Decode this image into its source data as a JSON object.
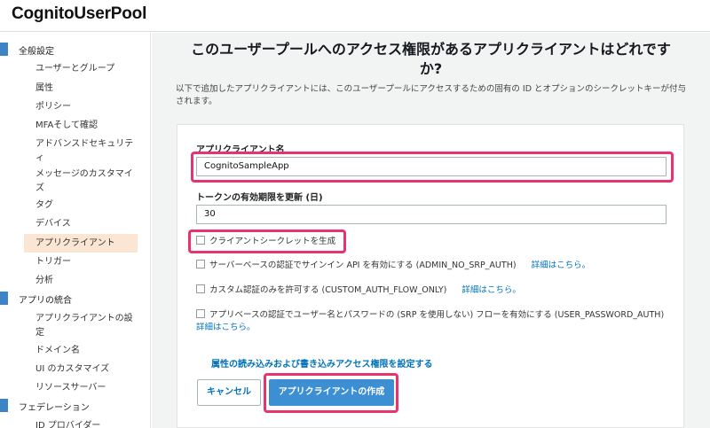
{
  "app": {
    "title": "CognitoUserPool"
  },
  "sidebar": {
    "sections": [
      {
        "label": "全般設定"
      },
      {
        "label": "アプリの統合"
      },
      {
        "label": "フェデレーション"
      }
    ],
    "general_items": [
      "ユーザーとグループ",
      "属性",
      "ポリシー",
      "MFAそして確認",
      "アドバンスドセキュリティ",
      "メッセージのカスタマイズ",
      "タグ",
      "デバイス",
      "アプリクライアント",
      "トリガー",
      "分析"
    ],
    "advanced_security_line1": "アドバンスドセキュリテ",
    "advanced_security_line2": "ィ",
    "message_custom_line1": "メッセージのカスタマイ",
    "message_custom_line2": "ズ",
    "integration_items": [
      "アプリクライアントの設定",
      "ドメイン名",
      "UI のカスタマイズ",
      "リソースサーバー"
    ],
    "app_client_settings_line1": "アプリクライアントの設",
    "app_client_settings_line2": "定",
    "federation_items": [
      "ID プロバイダー"
    ]
  },
  "main": {
    "heading_line1": "このユーザープールへのアクセス権限があるアプリクライアントはどれです",
    "heading_line2": "か?",
    "desc_line1": "以下で追加したアプリクライアントには、このユーザープールにアクセスするための固有の ID とオプションのシークレットキーが付与",
    "desc_line2": "されます。"
  },
  "form": {
    "client_name_label": "アプリクライアント名",
    "client_name_value": "CognitoSampleApp",
    "token_label": "トークンの有効期限を更新 (日)",
    "token_value": "30",
    "generate_secret": "クライアントシークレットを生成",
    "srp_auth": "サーバーベースの認証でサインイン API を有効にする (ADMIN_NO_SRP_AUTH)",
    "custom_auth": "カスタム認証のみを許可する (CUSTOM_AUTH_FLOW_ONLY)",
    "password_auth": "アプリベースの認証でユーザー名とパスワードの (SRP を使用しない) フローを有効にする (USER_PASSWORD_AUTH)",
    "details_link": "詳細はこちら。",
    "attr_link": "属性の読み込みおよび書き込みアクセス権限を設定する",
    "cancel_button": "キャンセル",
    "create_button": "アプリクライアントの作成"
  },
  "colors": {
    "accent": "#3d84c6",
    "highlight": "#e8336d",
    "active_bg": "#fbe6d4",
    "link": "#0073bb"
  }
}
